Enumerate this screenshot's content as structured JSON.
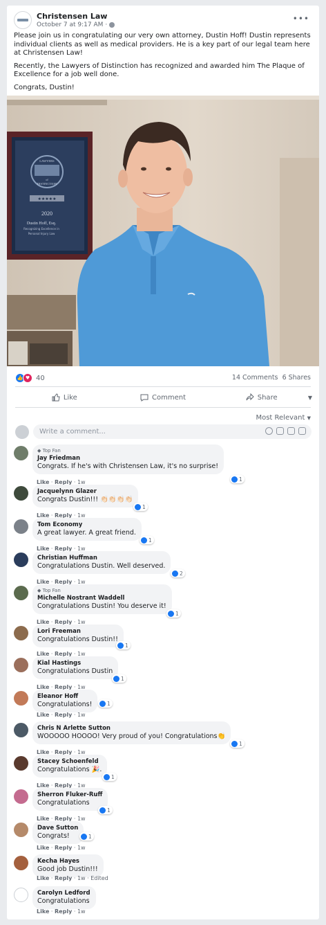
{
  "post": {
    "page_name": "Christensen Law",
    "timestamp": "October 7 at 9:17 AM",
    "privacy_sep": "·",
    "more": "•••",
    "paragraphs": [
      "Please join us in congratulating our very own attorney, Dustin Hoff! Dustin represents individual clients as well as medical providers. He is a key part of our legal team here at Christensen Law!",
      "Recently, the Lawyers of Distinction has recognized and awarded him The Plaque of Excellence for a job well done.",
      "Congrats, Dustin!"
    ],
    "plaque": {
      "line1": "LAWYERS",
      "line2": "of",
      "line3": "DISTINCTION",
      "year": "2020",
      "name": "Dustin Hoff, Esq.",
      "line4": "Recognizing Excellence in",
      "line5": "Personal Injury Law",
      "stars": "★★★★★"
    }
  },
  "stats": {
    "reaction_count": "40",
    "comments": "14 Comments",
    "shares": "6 Shares"
  },
  "actions": {
    "like": "Like",
    "comment": "Comment",
    "share": "Share"
  },
  "sort_label": "Most Relevant",
  "comment_box": {
    "placeholder": "Write a comment..."
  },
  "comment_ui": {
    "like": "Like",
    "reply": "Reply",
    "time": "1w",
    "dot": "·",
    "top_fan": "Top Fan"
  },
  "comments": [
    {
      "name": "Jay Friedman",
      "text": "Congrats. If he's with Christensen Law, it's no surprise!",
      "likes": "1",
      "top_fan": true
    },
    {
      "name": "Jacquelynn Glazer",
      "text": "Congrats Dustin!!! 👏🏻👏🏻👏🏻👏🏻",
      "likes": "1"
    },
    {
      "name": "Tom Economy",
      "text": "A great lawyer. A great friend.",
      "likes": "1"
    },
    {
      "name": "Christian Huffman",
      "text": "Congratulations Dustin. Well deserved.",
      "likes": "2"
    },
    {
      "name": "Michelle Nostrant Waddell",
      "text": "Congratulations Dustin! You deserve it!",
      "likes": "1",
      "top_fan": true
    },
    {
      "name": "Lori Freeman",
      "text": "Congratulations Dustin!!",
      "likes": "1"
    },
    {
      "name": "Kial Hastings",
      "text": "Congratulations Dustin",
      "likes": "1"
    },
    {
      "name": "Eleanor Hoff",
      "text": "Congratulations!",
      "likes": "1"
    },
    {
      "name": "Chris N Arlette Sutton",
      "text": "WOOOOO HOOOO! Very proud of you! Congratulations👏",
      "likes": "1"
    },
    {
      "name": "Stacey Schoenfeld",
      "text": "Congratulations 🎉.",
      "likes": "1"
    },
    {
      "name": "Sherron Fluker-Ruff",
      "text": "Congratulations",
      "likes": "1"
    },
    {
      "name": "Dave Sutton",
      "text": "Congrats!",
      "likes": "1"
    },
    {
      "name": "Kecha Hayes",
      "text": "Good job Dustin!!!",
      "edited": "Edited"
    },
    {
      "name": "Carolyn Ledford",
      "text": "Congratulations"
    }
  ],
  "colors": {
    "facebook_blue": "#1877f2",
    "love_red": "#e0245e",
    "bubble_gray": "#f2f3f5",
    "shirt_blue": "#4f9ad7"
  }
}
